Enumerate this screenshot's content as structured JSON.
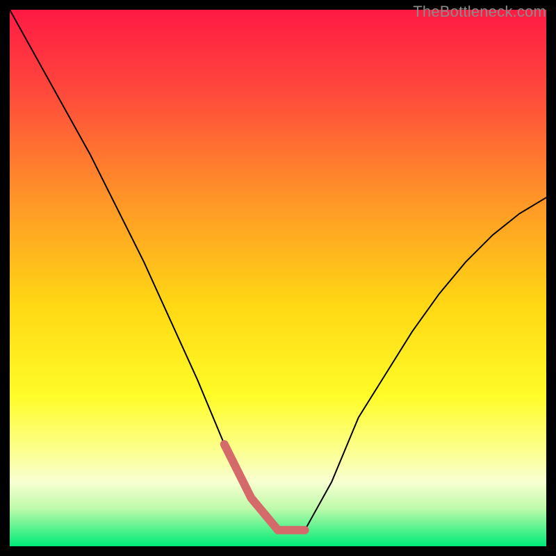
{
  "watermark": "TheBottleneck.com",
  "colors": {
    "frame": "#000000",
    "curve": "#000000",
    "trough": "#d46a6a",
    "watermark": "#8a8a8a"
  },
  "gradient_rows": 772,
  "gradient": {
    "stops": [
      {
        "t": 0.0,
        "r": 255,
        "g": 26,
        "b": 68
      },
      {
        "t": 0.15,
        "r": 255,
        "g": 72,
        "b": 60
      },
      {
        "t": 0.35,
        "r": 255,
        "g": 148,
        "b": 40
      },
      {
        "t": 0.55,
        "r": 255,
        "g": 216,
        "b": 20
      },
      {
        "t": 0.72,
        "r": 255,
        "g": 252,
        "b": 40
      },
      {
        "t": 0.82,
        "r": 252,
        "g": 255,
        "b": 140
      },
      {
        "t": 0.88,
        "r": 248,
        "g": 255,
        "b": 210
      },
      {
        "t": 0.93,
        "r": 190,
        "g": 250,
        "b": 170
      },
      {
        "t": 1.0,
        "r": 0,
        "g": 235,
        "b": 120
      }
    ]
  },
  "chart_data": {
    "type": "line",
    "title": "",
    "xlabel": "",
    "ylabel": "",
    "xlim": [
      0,
      100
    ],
    "ylim": [
      0,
      100
    ],
    "grid": false,
    "series": [
      {
        "name": "bottleneck-curve",
        "x": [
          0,
          5,
          10,
          15,
          20,
          25,
          30,
          35,
          40,
          45,
          50,
          55,
          60,
          65,
          70,
          75,
          80,
          85,
          90,
          95,
          100
        ],
        "values": [
          100,
          91,
          82,
          73,
          63,
          53,
          42,
          31,
          19,
          9,
          3,
          3,
          12,
          24,
          32,
          40,
          47,
          53,
          58,
          62,
          65
        ]
      }
    ],
    "annotations": [
      {
        "name": "optimal-range",
        "x_start": 42,
        "x_end": 56,
        "y": 3
      }
    ]
  }
}
